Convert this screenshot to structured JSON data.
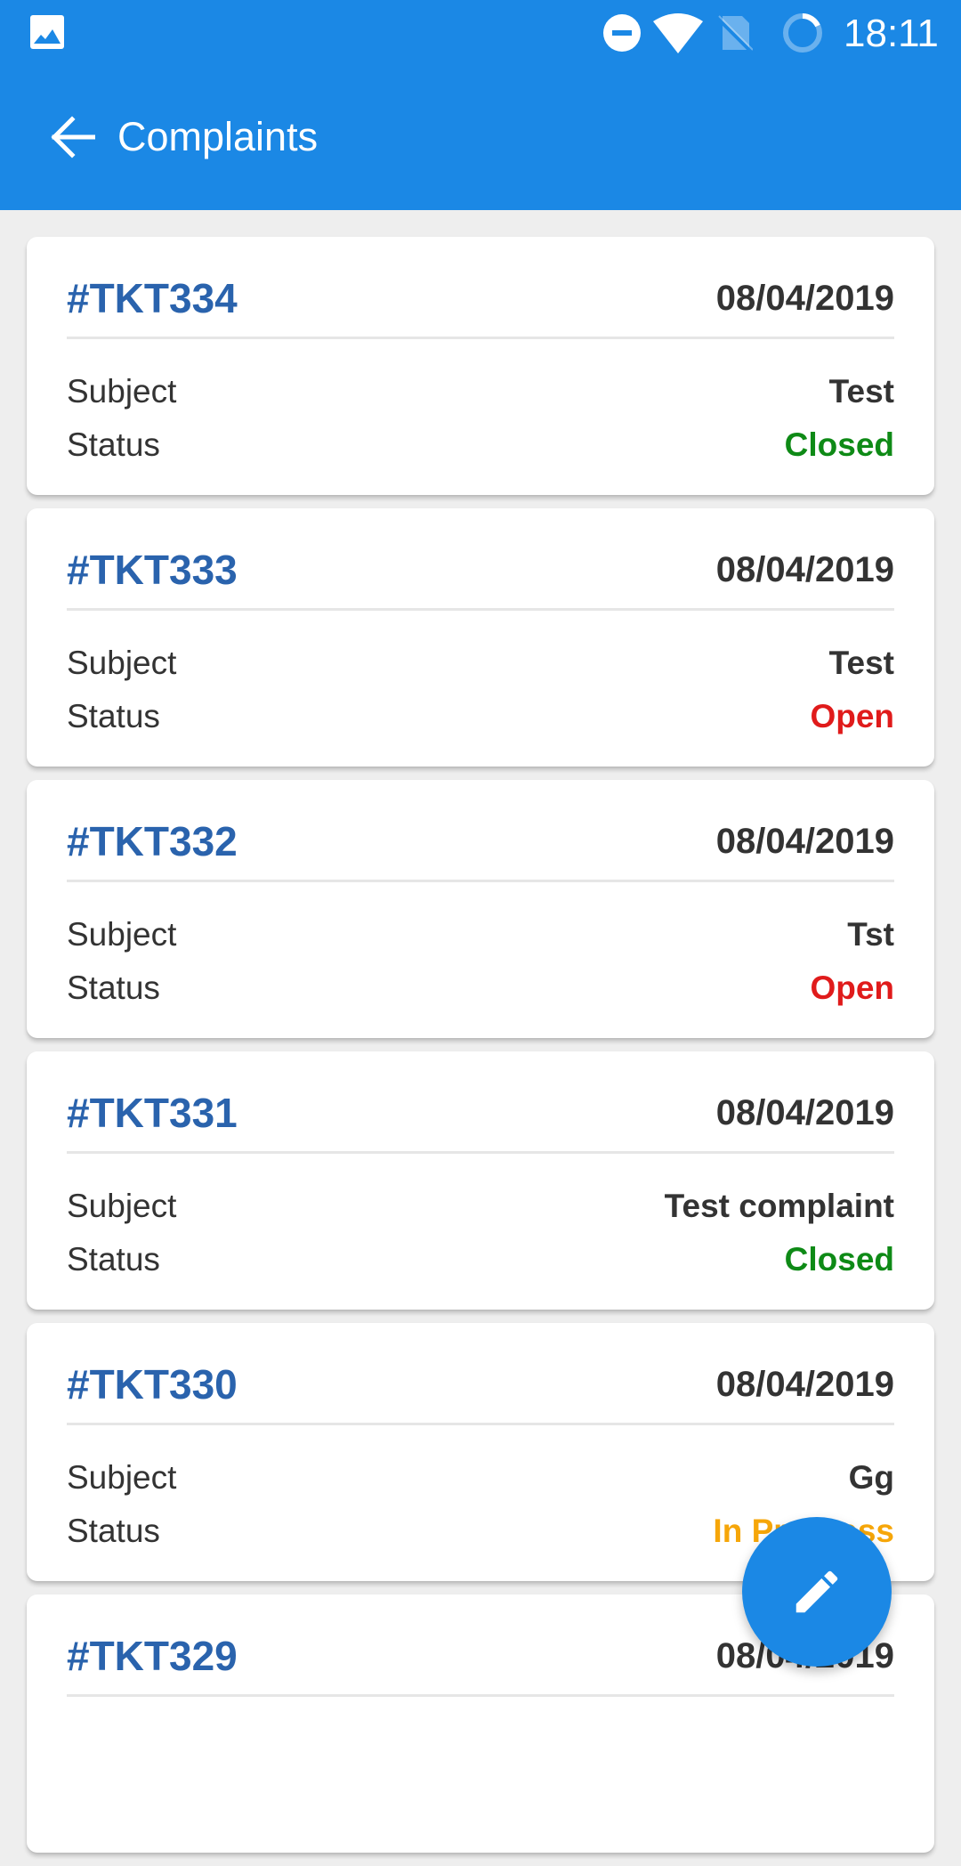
{
  "status_bar": {
    "time": "18:11",
    "icons": [
      "gallery-icon",
      "do-not-disturb-icon",
      "wifi-icon",
      "no-sim-icon",
      "battery-saver-icon"
    ]
  },
  "toolbar": {
    "back_icon": "arrow-left-icon",
    "title": "Complaints"
  },
  "labels": {
    "subject": "Subject",
    "status": "Status"
  },
  "status_colors": {
    "Closed": "#0e8a16",
    "Open": "#e01b1b",
    "In Progress": "#f6a609"
  },
  "complaints": [
    {
      "id": "#TKT334",
      "date": "08/04/2019",
      "subject": "Test",
      "status": "Closed"
    },
    {
      "id": "#TKT333",
      "date": "08/04/2019",
      "subject": "Test",
      "status": "Open"
    },
    {
      "id": "#TKT332",
      "date": "08/04/2019",
      "subject": "Tst",
      "status": "Open"
    },
    {
      "id": "#TKT331",
      "date": "08/04/2019",
      "subject": "Test complaint",
      "status": "Closed"
    },
    {
      "id": "#TKT330",
      "date": "08/04/2019",
      "subject": "Gg",
      "status": "In Progress"
    },
    {
      "id": "#TKT329",
      "date": "08/04/2019",
      "subject": "",
      "status": ""
    }
  ],
  "fab": {
    "icon": "pencil-icon",
    "action": "new-complaint"
  }
}
